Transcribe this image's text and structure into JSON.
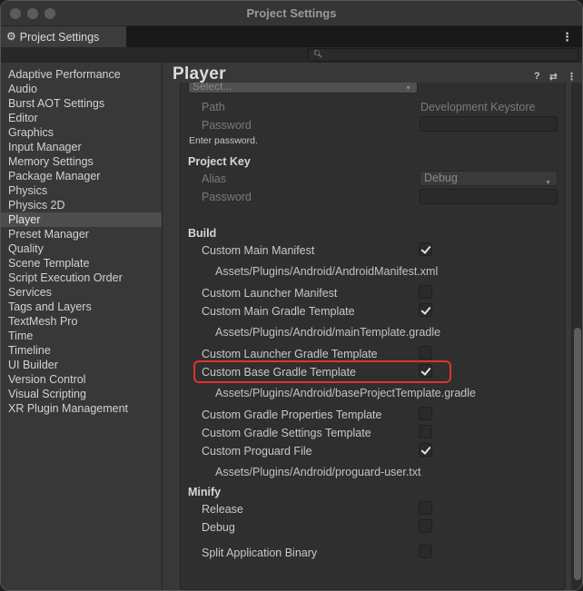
{
  "window": {
    "title": "Project Settings"
  },
  "tab": {
    "label": "Project Settings",
    "icon": "gear-icon"
  },
  "sidebar": {
    "selected": "Player",
    "items": [
      "Adaptive Performance",
      "Audio",
      "Burst AOT Settings",
      "Editor",
      "Graphics",
      "Input Manager",
      "Memory Settings",
      "Package Manager",
      "Physics",
      "Physics 2D",
      "Player",
      "Preset Manager",
      "Quality",
      "Scene Template",
      "Script Execution Order",
      "Services",
      "Tags and Layers",
      "TextMesh Pro",
      "Time",
      "Timeline",
      "UI Builder",
      "Version Control",
      "Visual Scripting",
      "XR Plugin Management"
    ]
  },
  "main": {
    "heading": "Player",
    "top_select": "Select...",
    "keystore": {
      "path_label": "Path",
      "path_value": "Development Keystore",
      "password_label": "Password",
      "hint": "Enter password."
    },
    "project_key": {
      "title": "Project Key",
      "alias_label": "Alias",
      "alias_value": "Debug",
      "password_label": "Password"
    },
    "build": {
      "title": "Build",
      "items": [
        {
          "label": "Custom Main Manifest",
          "checked": true,
          "path": "Assets/Plugins/Android/AndroidManifest.xml"
        },
        {
          "label": "Custom Launcher Manifest",
          "checked": false
        },
        {
          "label": "Custom Main Gradle Template",
          "checked": true,
          "path": "Assets/Plugins/Android/mainTemplate.gradle"
        },
        {
          "label": "Custom Launcher Gradle Template",
          "checked": false
        },
        {
          "label": "Custom Base Gradle Template",
          "checked": true,
          "path": "Assets/Plugins/Android/baseProjectTemplate.gradle",
          "highlighted": true
        },
        {
          "label": "Custom Gradle Properties Template",
          "checked": false
        },
        {
          "label": "Custom Gradle Settings Template",
          "checked": false
        },
        {
          "label": "Custom Proguard File",
          "checked": true,
          "path": "Assets/Plugins/Android/proguard-user.txt"
        }
      ]
    },
    "minify": {
      "title": "Minify",
      "release_label": "Release",
      "release_checked": false,
      "debug_label": "Debug",
      "debug_checked": false
    },
    "split_binary": {
      "label": "Split Application Binary",
      "checked": false
    }
  },
  "colors": {
    "highlight": "#e0332c",
    "window_bg": "#383838"
  }
}
